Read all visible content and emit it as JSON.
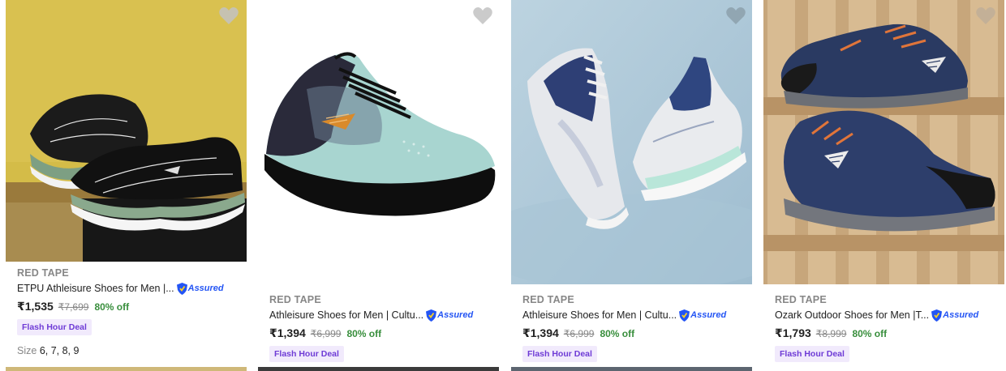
{
  "products": [
    {
      "brand": "RED TAPE",
      "title": "ETPU Athleisure Shoes for Men |...",
      "assured": "Assured",
      "price": "₹1,535",
      "mrp": "₹7,699",
      "discount": "80% off",
      "deal": "Flash Hour Deal",
      "size_label": "Size",
      "sizes": "6, 7, 8, 9",
      "image": "black-green-sneakers-on-yellow-backdrop",
      "wishlist_icon": "heart-icon"
    },
    {
      "brand": "RED TAPE",
      "title": "Athleisure Shoes for Men | Cultu...",
      "assured": "Assured",
      "price": "₹1,394",
      "mrp": "₹6,999",
      "discount": "80% off",
      "deal": "Flash Hour Deal",
      "image": "mint-black-running-shoe-on-white",
      "wishlist_icon": "heart-icon"
    },
    {
      "brand": "RED TAPE",
      "title": "Athleisure Shoes for Men | Cultu...",
      "assured": "Assured",
      "price": "₹1,394",
      "mrp": "₹6,999",
      "discount": "80% off",
      "deal": "Flash Hour Deal",
      "image": "navy-white-sneakers-on-blue-backdrop",
      "wishlist_icon": "heart-icon"
    },
    {
      "brand": "RED TAPE",
      "title": "Ozark Outdoor Shoes for Men |T...",
      "assured": "Assured",
      "price": "₹1,793",
      "mrp": "₹8,999",
      "discount": "80% off",
      "deal": "Flash Hour Deal",
      "image": "navy-outdoor-shoes-on-wooden-fence",
      "wishlist_icon": "heart-icon"
    }
  ],
  "colors": {
    "brand_text": "#878787",
    "discount": "#388e3c",
    "deal_bg": "#f1eafc",
    "deal_text": "#6e3bd6",
    "assured": "#2455f4"
  }
}
